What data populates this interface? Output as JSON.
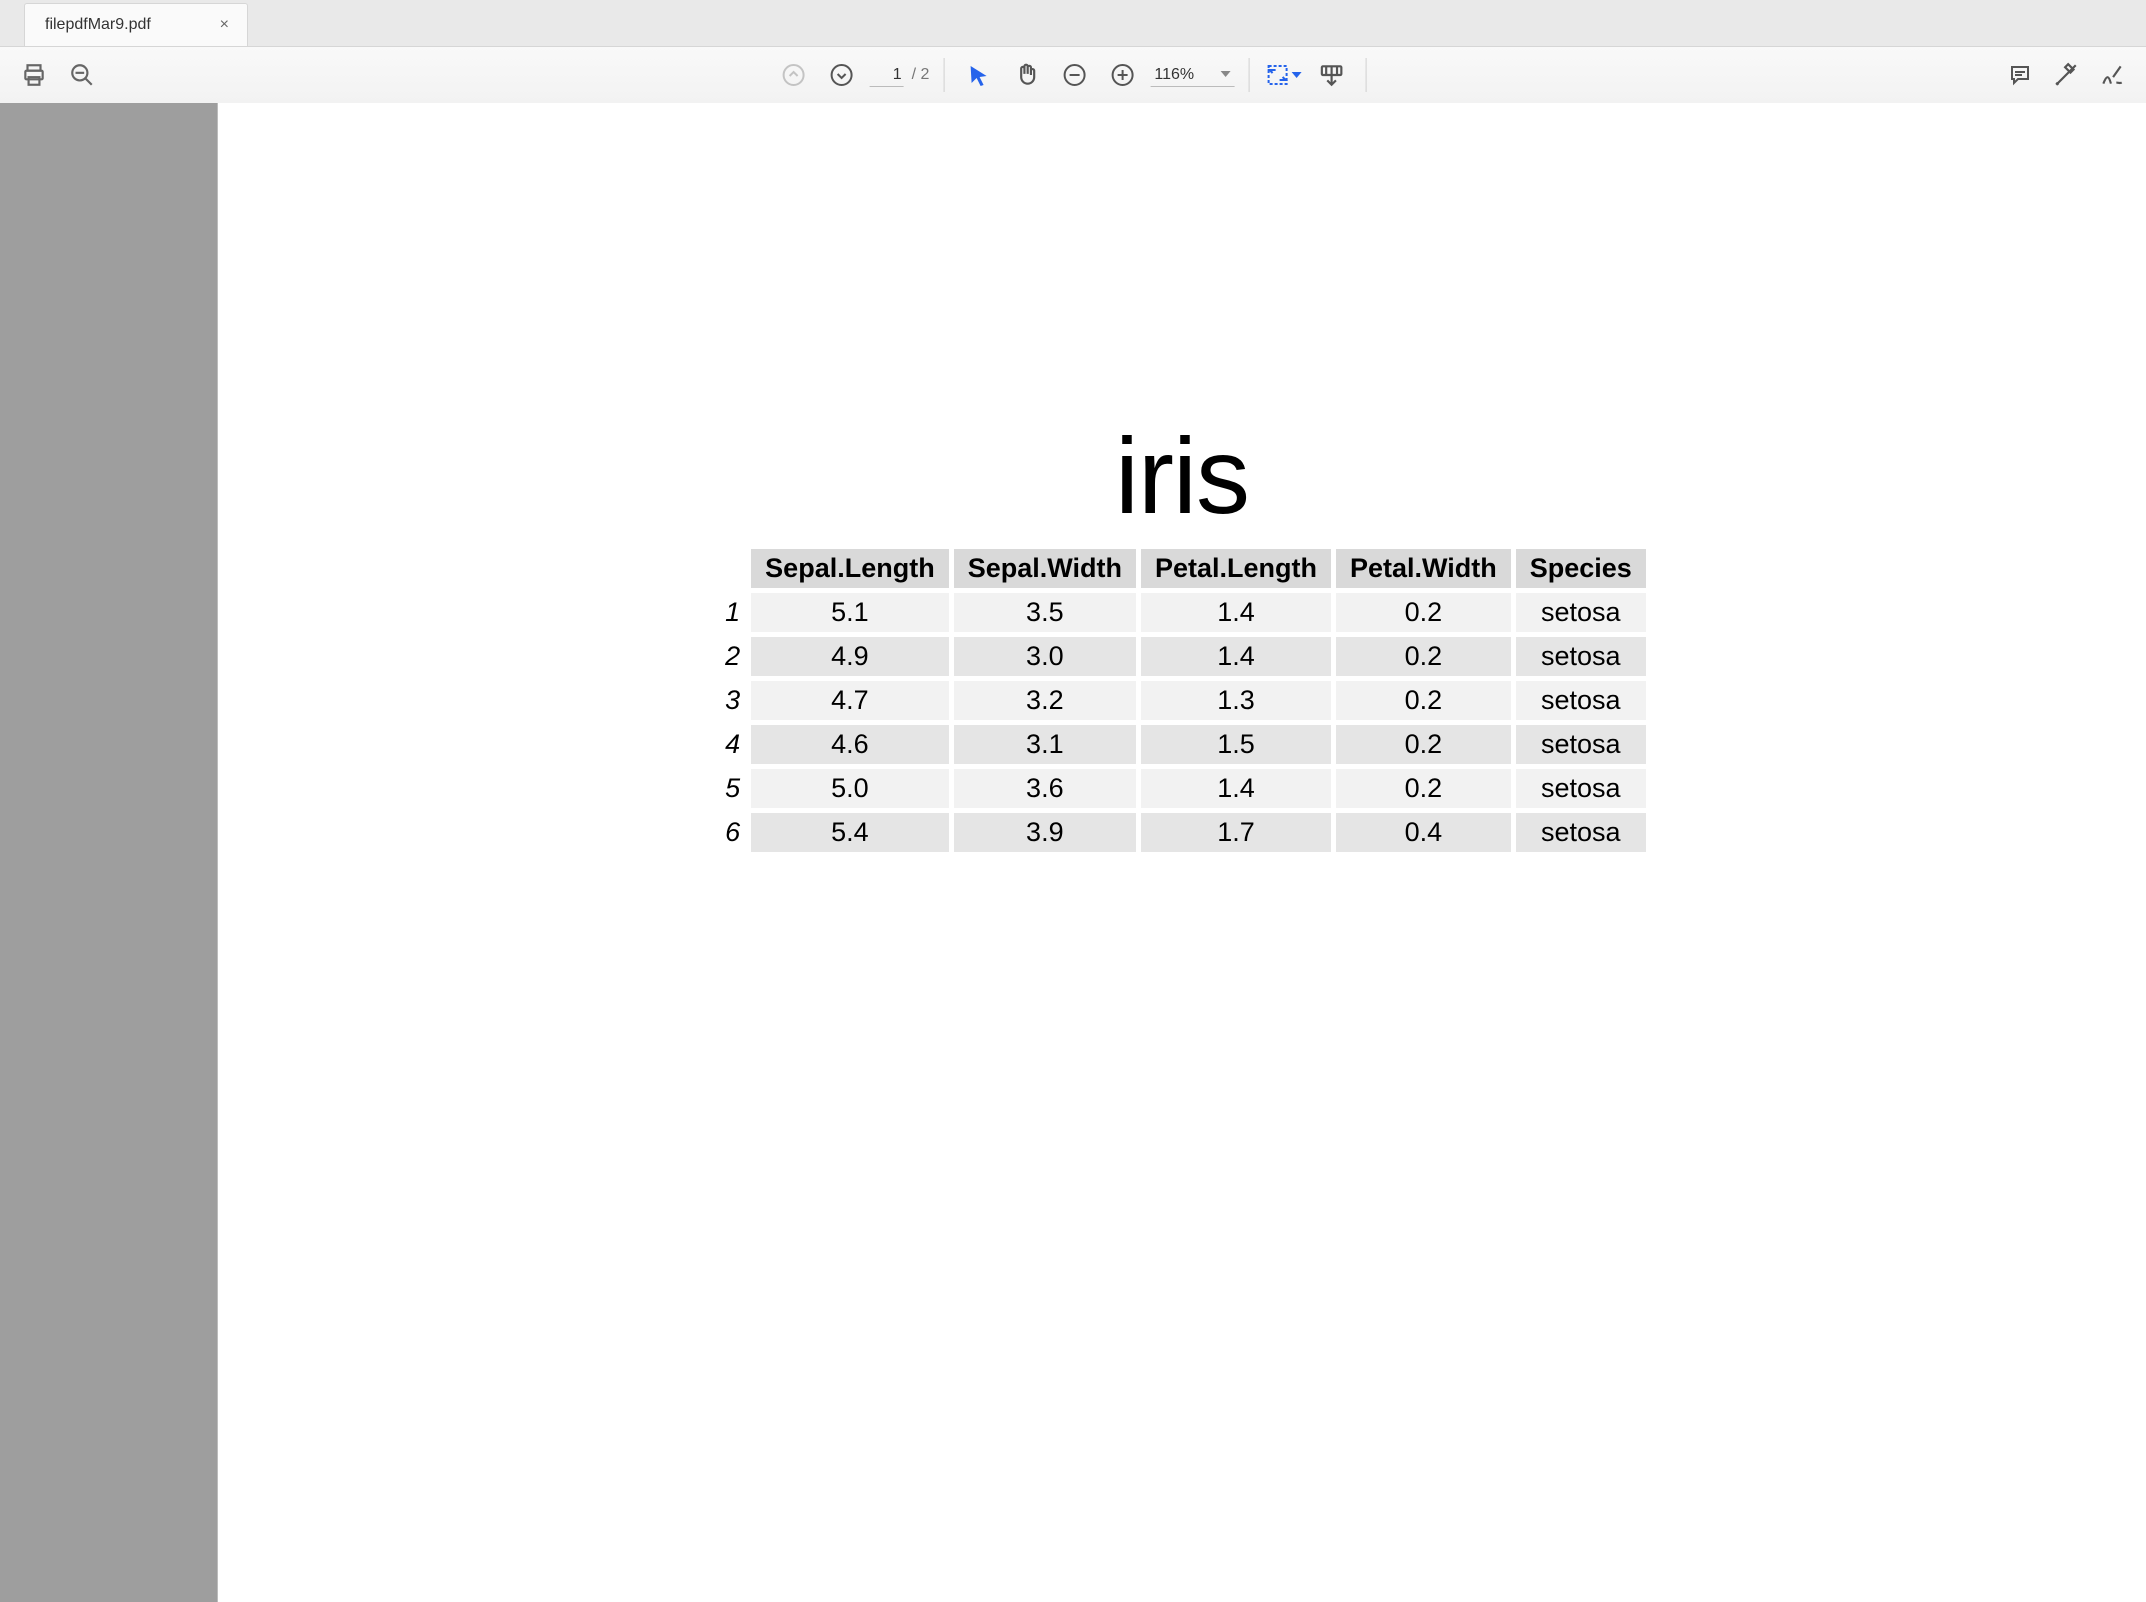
{
  "tab": {
    "title": "filepdfMar9.pdf",
    "close": "×"
  },
  "toolbar": {
    "page_current": "1",
    "page_sep": "/ 2",
    "zoom_label": "116%"
  },
  "document": {
    "title": "iris",
    "columns": [
      "Sepal.Length",
      "Sepal.Width",
      "Petal.Length",
      "Petal.Width",
      "Species"
    ],
    "rows": [
      {
        "idx": "1",
        "cells": [
          "5.1",
          "3.5",
          "1.4",
          "0.2",
          "setosa"
        ]
      },
      {
        "idx": "2",
        "cells": [
          "4.9",
          "3.0",
          "1.4",
          "0.2",
          "setosa"
        ]
      },
      {
        "idx": "3",
        "cells": [
          "4.7",
          "3.2",
          "1.3",
          "0.2",
          "setosa"
        ]
      },
      {
        "idx": "4",
        "cells": [
          "4.6",
          "3.1",
          "1.5",
          "0.2",
          "setosa"
        ]
      },
      {
        "idx": "5",
        "cells": [
          "5.0",
          "3.6",
          "1.4",
          "0.2",
          "setosa"
        ]
      },
      {
        "idx": "6",
        "cells": [
          "5.4",
          "3.9",
          "1.7",
          "0.4",
          "setosa"
        ]
      }
    ]
  }
}
